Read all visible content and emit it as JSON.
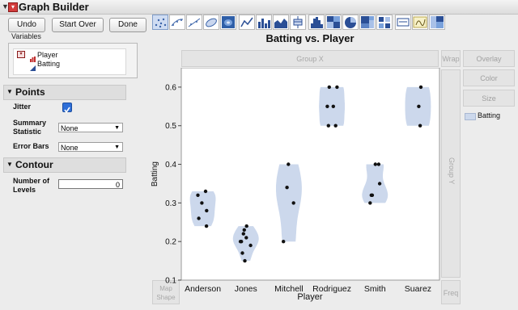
{
  "window": {
    "title": "Graph Builder"
  },
  "toolbar": {
    "undo": "Undo",
    "start_over": "Start Over",
    "done": "Done"
  },
  "variables": {
    "label": "Variables",
    "items": [
      "Player",
      "Batting"
    ]
  },
  "points": {
    "header": "Points",
    "jitter_label": "Jitter",
    "jitter_checked": true,
    "summary_label_1": "Summary",
    "summary_label_2": "Statistic",
    "summary_value": "None",
    "error_bars_label": "Error Bars",
    "error_bars_value": "None"
  },
  "contour": {
    "header": "Contour",
    "levels_label_1": "Number of",
    "levels_label_2": "Levels",
    "levels_value": "0"
  },
  "zones": {
    "group_x": "Group X",
    "group_y": "Group Y",
    "wrap": "Wrap",
    "overlay": "Overlay",
    "color": "Color",
    "size": "Size",
    "map_shape_1": "Map",
    "map_shape_2": "Shape",
    "freq": "Freq"
  },
  "legend": {
    "item": "Batting",
    "color": "#ccd8ec"
  },
  "chart_data": {
    "type": "violin",
    "title": "Batting vs. Player",
    "xlabel": "Player",
    "ylabel": "Batting",
    "ylim": [
      0.1,
      0.65
    ],
    "yticks": [
      "0.1",
      "0.2",
      "0.3",
      "0.4",
      "0.5",
      "0.6"
    ],
    "categories": [
      "Anderson",
      "Jones",
      "Mitchell",
      "Rodriguez",
      "Smith",
      "Suarez"
    ],
    "fill_color": "#ccd8ec",
    "point_color": "#111111",
    "points": [
      [
        0.33,
        0.32,
        0.3,
        0.28,
        0.26,
        0.24
      ],
      [
        0.24,
        0.23,
        0.22,
        0.21,
        0.2,
        0.2,
        0.19,
        0.17,
        0.15
      ],
      [
        0.4,
        0.34,
        0.3,
        0.2
      ],
      [
        0.6,
        0.6,
        0.55,
        0.55,
        0.5,
        0.5
      ],
      [
        0.4,
        0.4,
        0.35,
        0.32,
        0.32,
        0.3
      ],
      [
        0.6,
        0.55,
        0.5
      ]
    ]
  }
}
